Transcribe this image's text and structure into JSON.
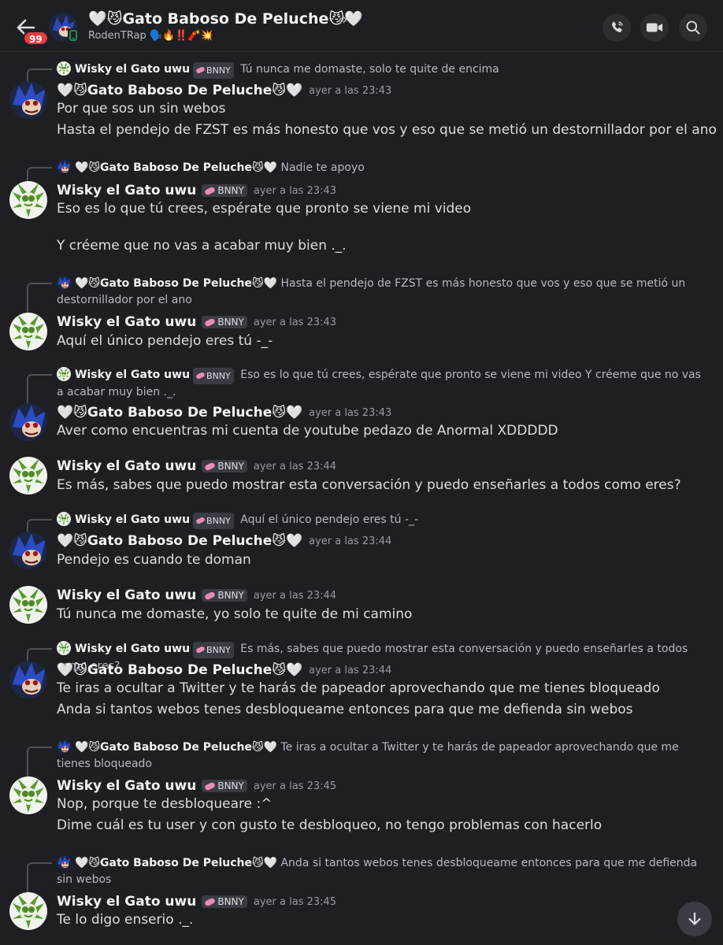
{
  "header": {
    "unread_count": "99",
    "title": "🤍😼Gato Baboso De Peluche😼🤍",
    "subtitle": "RodenTRap 🗣️🔥‼️🧨💥"
  },
  "messages": [
    {
      "reply": {
        "author": "Wisky el Gato uwu",
        "tag": "BNNY",
        "text": "Tú nunca me domaste, solo te quite de encima"
      },
      "author": "🤍😼Gato Baboso De Peluche😼🤍",
      "time": "ayer a las 23:43",
      "lines": [
        "Por que sos un sin webos",
        "Hasta el pendejo de FZST es más honesto que vos y eso que se metió un destornillador por el ano"
      ]
    },
    {
      "reply": {
        "author": "🤍😼Gato Baboso De Peluche😼🤍",
        "text": "Nadie te apoyo"
      },
      "author": "Wisky el Gato uwu",
      "tag": "BNNY",
      "time": "ayer a las 23:43",
      "lines": [
        "Eso es lo que tú crees, espérate que pronto se viene mi video",
        "Y créeme que no vas a acabar muy bien ._."
      ]
    },
    {
      "reply": {
        "author": "🤍😼Gato Baboso De Peluche😼🤍",
        "text": "Hasta el pendejo de FZST es más honesto que vos y eso que se metió un destornillador por el ano"
      },
      "author": "Wisky el Gato uwu",
      "tag": "BNNY",
      "time": "ayer a las 23:43",
      "lines": [
        "Aquí el único pendejo eres tú -_-"
      ]
    },
    {
      "reply": {
        "author": "Wisky el Gato uwu",
        "tag": "BNNY",
        "text": "Eso es lo que tú crees, espérate que pronto se viene mi video  Y créeme que no vas a acabar muy bien ._."
      },
      "author": "🤍😼Gato Baboso De Peluche😼🤍",
      "time": "ayer a las 23:43",
      "lines": [
        "Aver como encuentras mi cuenta de youtube pedazo de Anormal XDDDDD"
      ]
    },
    {
      "author": "Wisky el Gato uwu",
      "tag": "BNNY",
      "time": "ayer a las 23:44",
      "lines": [
        "Es más, sabes que puedo mostrar esta conversación y puedo enseñarles a todos como eres?"
      ]
    },
    {
      "reply": {
        "author": "Wisky el Gato uwu",
        "tag": "BNNY",
        "text": "Aquí el único pendejo eres tú -_-"
      },
      "author": "🤍😼Gato Baboso De Peluche😼🤍",
      "time": "ayer a las 23:44",
      "lines": [
        "Pendejo es cuando te doman"
      ]
    },
    {
      "author": "Wisky el Gato uwu",
      "tag": "BNNY",
      "time": "ayer a las 23:44",
      "lines": [
        "Tú nunca me domaste, yo solo te quite de mi camino"
      ]
    },
    {
      "reply": {
        "author": "Wisky el Gato uwu",
        "tag": "BNNY",
        "text": "Es más, sabes que puedo mostrar esta conversación y puedo enseñarles a todos como eres?"
      },
      "author": "🤍😼Gato Baboso De Peluche😼🤍",
      "time": "ayer a las 23:44",
      "lines": [
        "Te iras a ocultar a Twitter y te harás de papeador aprovechando que me tienes bloqueado",
        "Anda si tantos webos tenes desbloqueame entonces para que me defienda sin webos"
      ]
    },
    {
      "reply": {
        "author": "🤍😼Gato Baboso De Peluche😼🤍",
        "text": "Te iras a ocultar a Twitter y te harás de papeador aprovechando que me tienes bloqueado"
      },
      "author": "Wisky el Gato uwu",
      "tag": "BNNY",
      "time": "ayer a las 23:45",
      "lines": [
        "Nop, porque te desbloqueare :^",
        "Dime cuál es tu user y con gusto te desbloqueo, no tengo problemas con hacerlo"
      ]
    },
    {
      "reply": {
        "author": "🤍😼Gato Baboso De Peluche😼🤍",
        "text": "Anda si tantos webos tenes desbloqueame entonces para que me defienda sin webos"
      },
      "author": "Wisky el Gato uwu",
      "tag": "BNNY",
      "time": "ayer a las 23:45",
      "lines": [
        "Te lo digo enserio ._."
      ]
    }
  ]
}
